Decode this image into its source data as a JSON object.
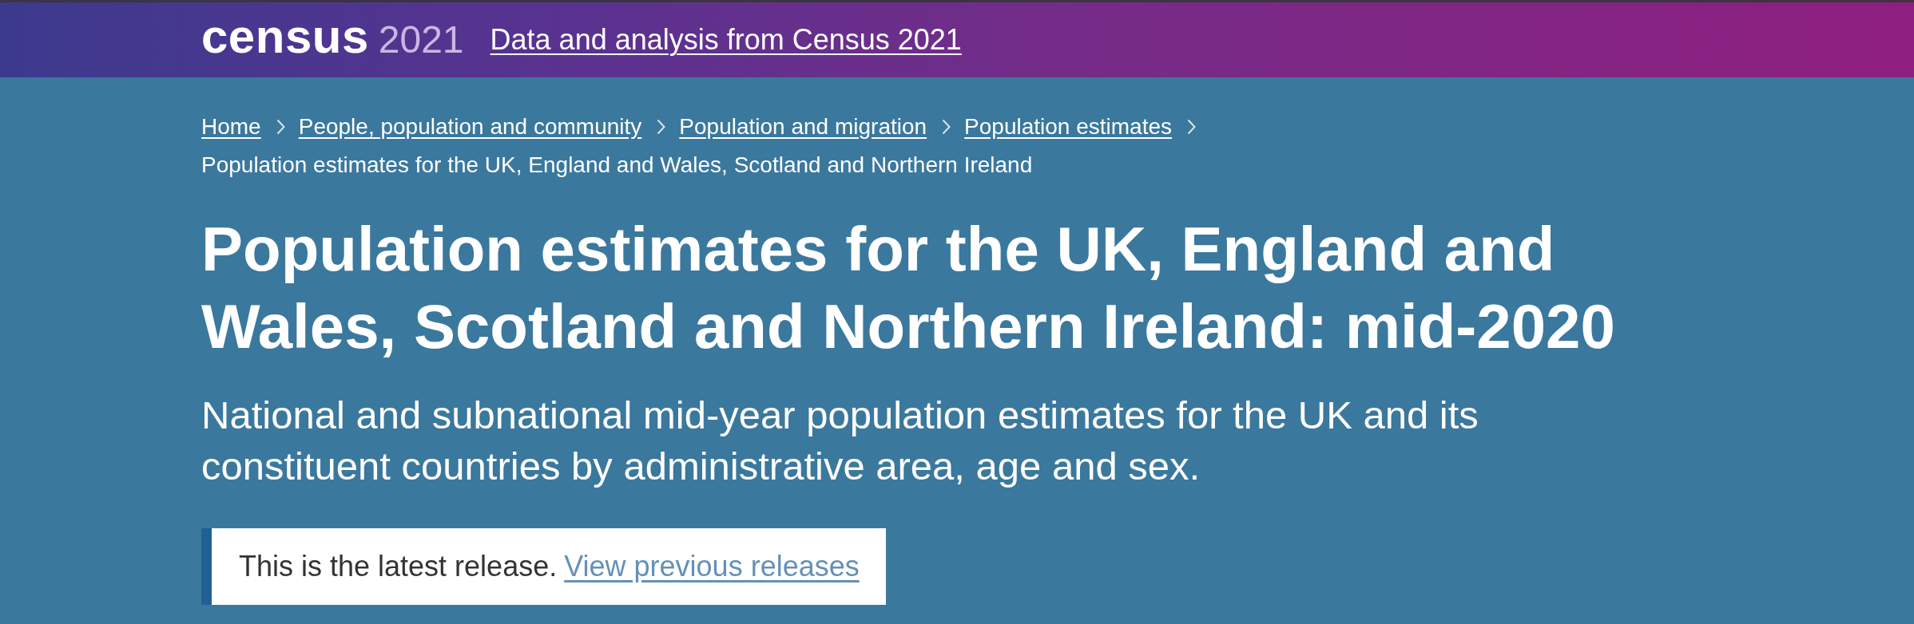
{
  "header": {
    "logo": {
      "wordmark": "census",
      "year": "2021"
    },
    "link": "Data and analysis from Census 2021"
  },
  "breadcrumb": {
    "links": [
      "Home",
      "People, population and community",
      "Population and migration",
      "Population estimates"
    ],
    "current": "Population estimates for the UK, England and Wales, Scotland and Northern Ireland"
  },
  "title": "Population estimates for the UK, England and Wales, Scotland and Northern Ireland: mid-2020",
  "subtitle": "National and subnational mid-year population estimates for the UK and its constituent countries by administrative area, age and sex.",
  "notice": {
    "text": "This is the latest release.",
    "link": "View previous releases"
  }
}
